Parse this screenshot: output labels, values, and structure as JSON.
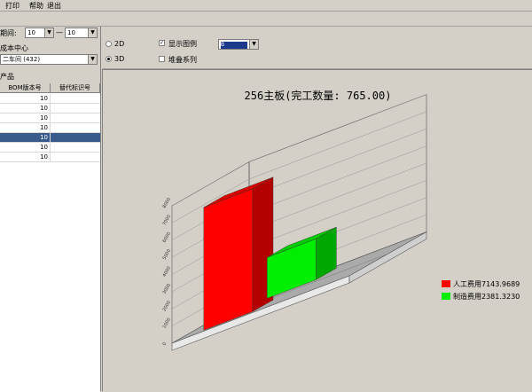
{
  "menu": {
    "items": [
      "打印",
      "帮助",
      "退出"
    ]
  },
  "filters": {
    "period_label": "期间:",
    "period_from": "10",
    "period_sep": "—",
    "period_to": "10",
    "cost_center_label": "成本中心",
    "cost_center_value": "二车间 (432)",
    "products_label": "产品"
  },
  "grid": {
    "headers": [
      "BOM版本号",
      "替代标识号"
    ],
    "rows": [
      {
        "bom": "10",
        "alt": "",
        "selected": false
      },
      {
        "bom": "10",
        "alt": "",
        "selected": false
      },
      {
        "bom": "10",
        "alt": "",
        "selected": false
      },
      {
        "bom": "10",
        "alt": "",
        "selected": false
      },
      {
        "bom": "10",
        "alt": "",
        "selected": true
      },
      {
        "bom": "10",
        "alt": "",
        "selected": false
      },
      {
        "bom": "10",
        "alt": "",
        "selected": false
      }
    ]
  },
  "options": {
    "radio_2d": "2D",
    "radio_3d": "3D",
    "selected_mode": "3D",
    "show_legend_label": "显示图例",
    "show_legend_checked": true,
    "stack_series_label": "堆叠系列",
    "stack_series_checked": false,
    "style_select_value": "B"
  },
  "chart_data": {
    "type": "bar",
    "title": "256主板(完工数量: 765.00)",
    "series": [
      {
        "name": "人工费用",
        "value": 7143.9689,
        "color": "#ff0000"
      },
      {
        "name": "制造费用",
        "value": 2381.323,
        "color": "#00ee00"
      }
    ],
    "legend": [
      {
        "text": "人工费用7143.9689",
        "color": "#ff0000"
      },
      {
        "text": "制造费用2381.3230",
        "color": "#00ee00"
      }
    ],
    "legend_position": "right",
    "ylim": [
      0,
      8000
    ],
    "yticks": [
      "0",
      "1000",
      "2000",
      "3000",
      "4000",
      "5000",
      "6000",
      "7000",
      "8000"
    ],
    "projection": "3d"
  }
}
